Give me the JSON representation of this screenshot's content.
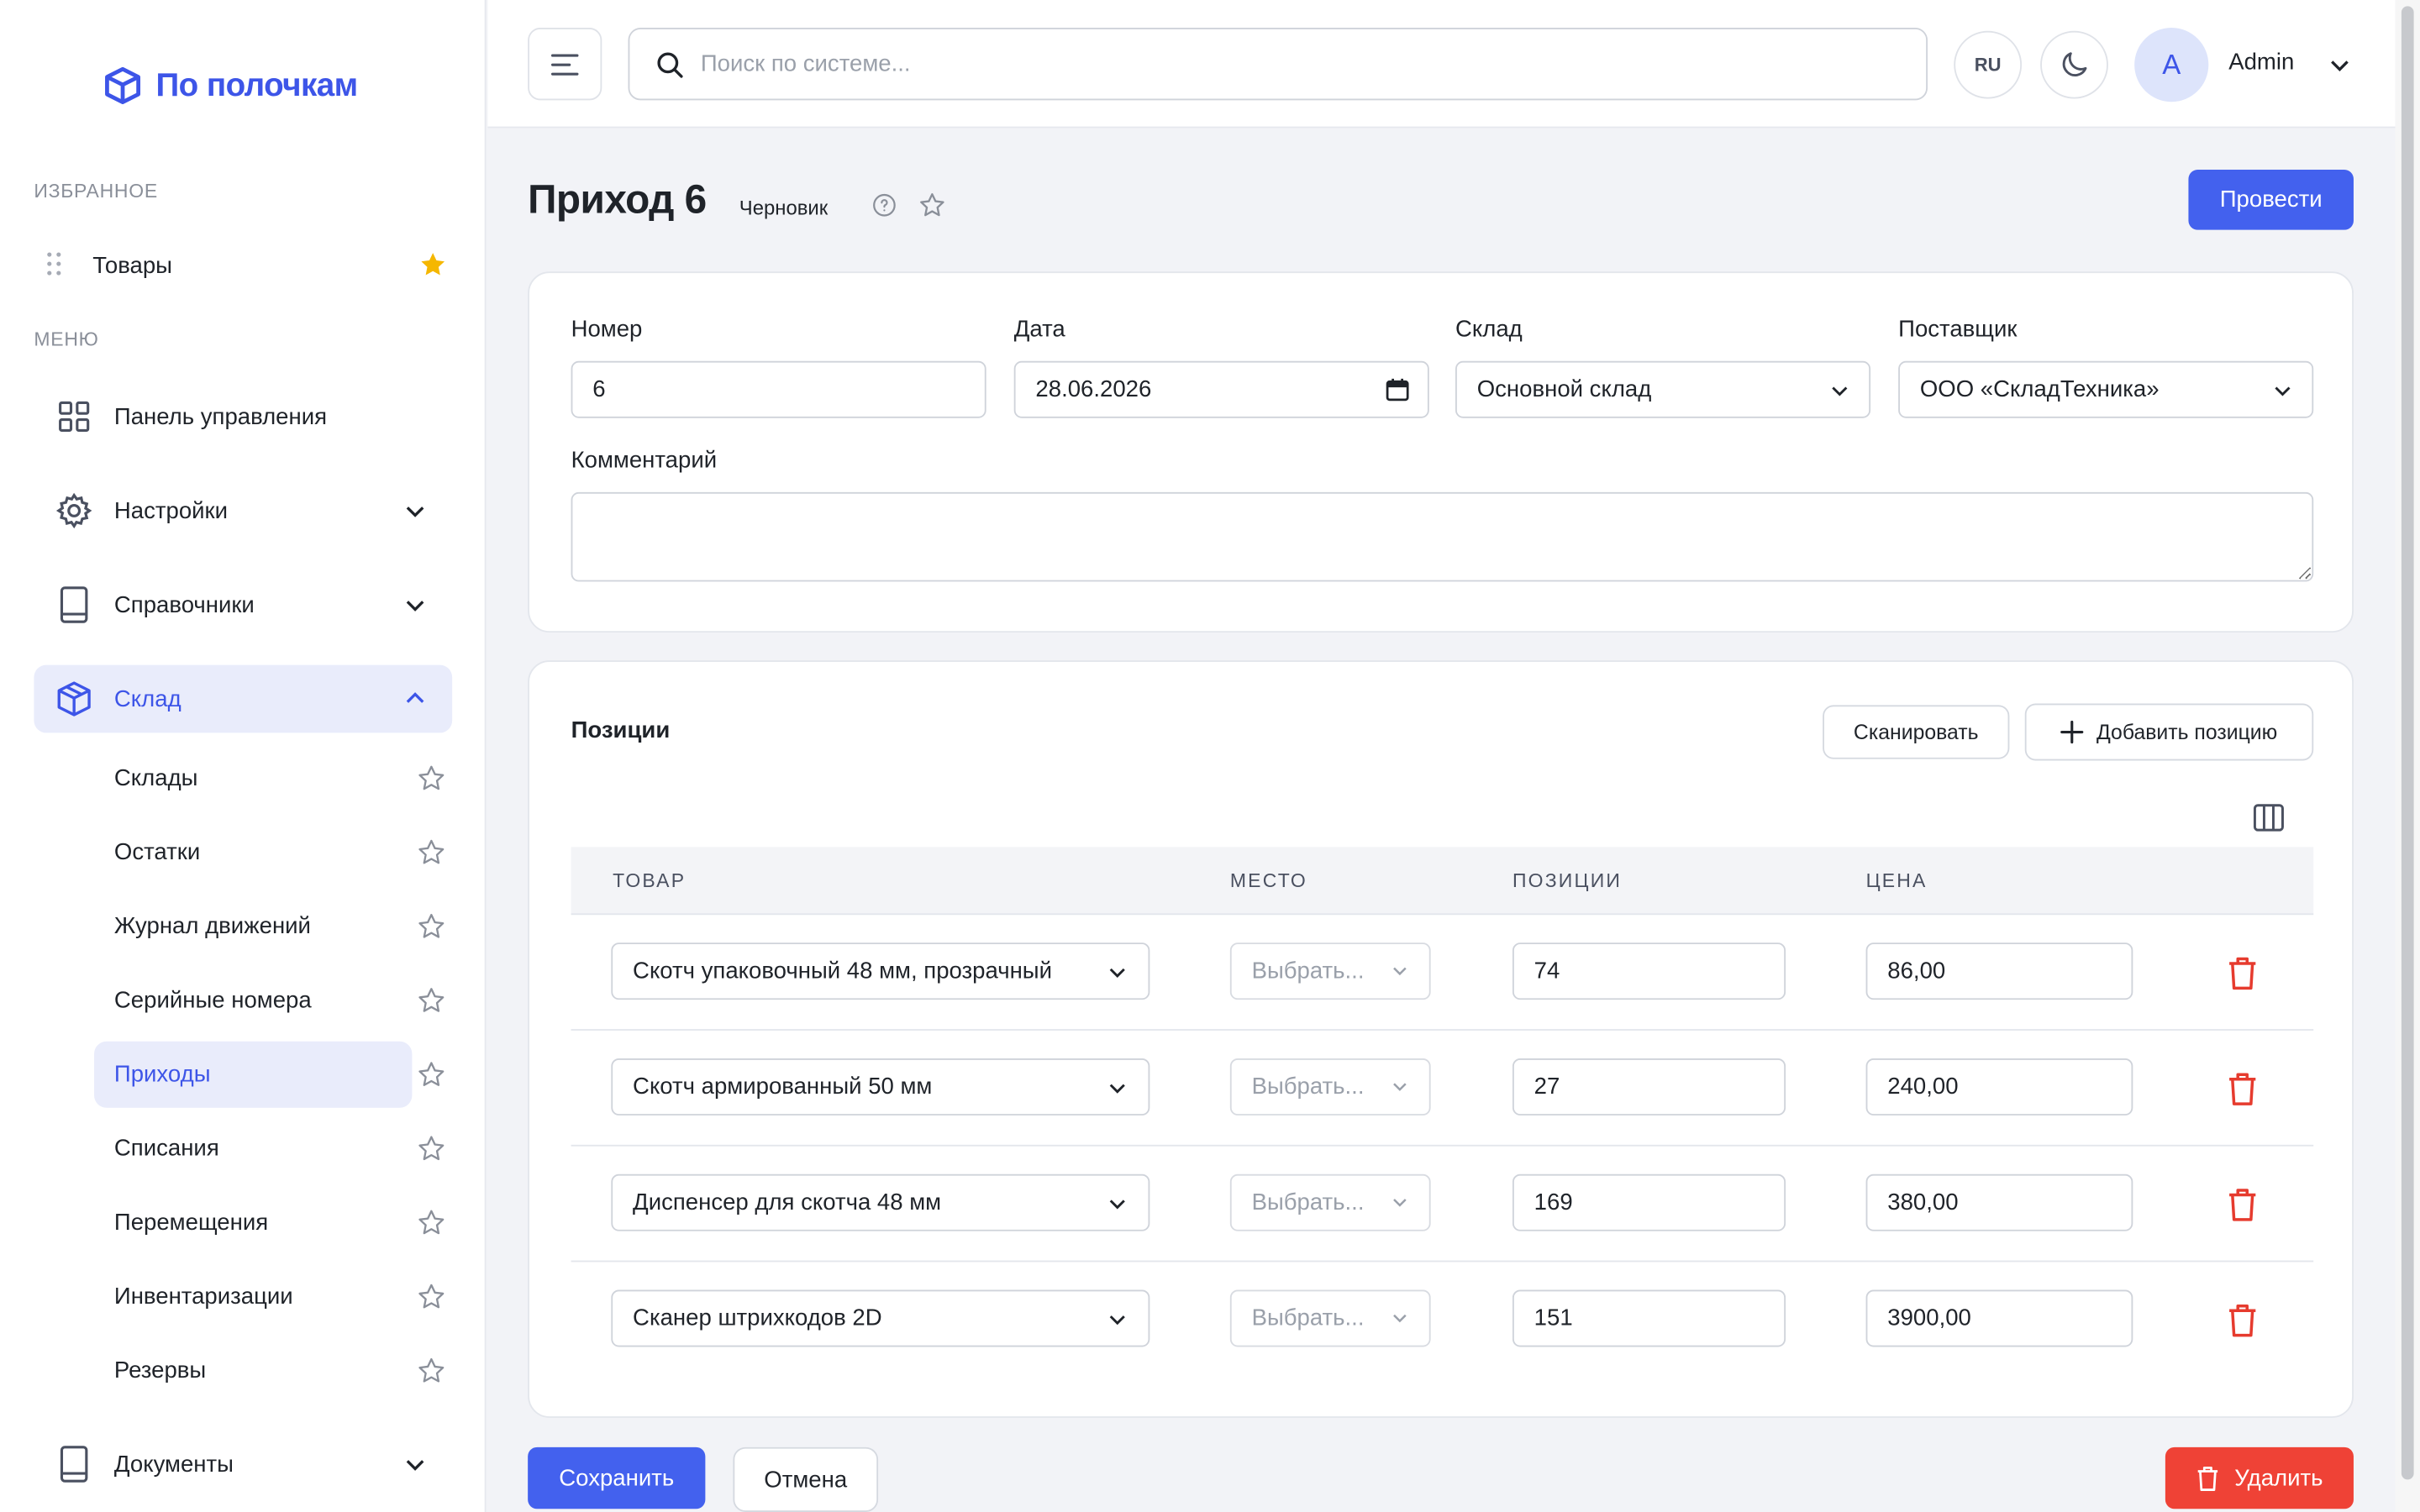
{
  "brand": {
    "name": "По полочкам",
    "color": "#3d55e8"
  },
  "sidebar": {
    "favorites_label": "ИЗБРАННОЕ",
    "favorites": [
      {
        "label": "Товары",
        "starred": true
      }
    ],
    "menu_label": "МЕНЮ",
    "items": [
      {
        "label": "Панель управления",
        "icon": "dashboard-icon"
      },
      {
        "label": "Настройки",
        "icon": "gear-icon",
        "expandable": true
      },
      {
        "label": "Справочники",
        "icon": "book-icon",
        "expandable": true
      },
      {
        "label": "Склад",
        "icon": "box-icon",
        "expanded": true,
        "active": true
      },
      {
        "label": "Документы",
        "icon": "book-icon",
        "expandable": true
      }
    ],
    "sklad_sub": [
      {
        "label": "Склады"
      },
      {
        "label": "Остатки"
      },
      {
        "label": "Журнал движений"
      },
      {
        "label": "Серийные номера"
      },
      {
        "label": "Приходы",
        "active": true
      },
      {
        "label": "Списания"
      },
      {
        "label": "Перемещения"
      },
      {
        "label": "Инвентаризации"
      },
      {
        "label": "Резервы"
      }
    ]
  },
  "topbar": {
    "search_placeholder": "Поиск по системе...",
    "lang": "RU",
    "avatar_letter": "A",
    "user_name": "Admin"
  },
  "page": {
    "title": "Приход 6",
    "status": "Черновик",
    "post_button": "Провести"
  },
  "form": {
    "number": {
      "label": "Номер",
      "value": "6"
    },
    "date": {
      "label": "Дата",
      "value": "28.06.2026"
    },
    "warehouse": {
      "label": "Склад",
      "value": "Основной склад"
    },
    "supplier": {
      "label": "Поставщик",
      "value": "ООО «СкладТехника»"
    },
    "comment": {
      "label": "Комментарий",
      "value": ""
    }
  },
  "positions": {
    "title": "Позиции",
    "scan_button": "Сканировать",
    "add_button": "Добавить позицию",
    "columns": [
      "ТОВАР",
      "МЕСТО",
      "ПОЗИЦИИ",
      "ЦЕНА"
    ],
    "place_placeholder": "Выбрать...",
    "rows": [
      {
        "product": "Скотч упаковочный 48 мм, прозрачный",
        "qty": "74",
        "price": "86,00"
      },
      {
        "product": "Скотч армированный 50 мм",
        "qty": "27",
        "price": "240,00"
      },
      {
        "product": "Диспенсер для скотча 48 мм",
        "qty": "169",
        "price": "380,00"
      },
      {
        "product": "Сканер штрихкодов 2D",
        "qty": "151",
        "price": "3900,00"
      }
    ]
  },
  "footer": {
    "save_button": "Сохранить",
    "cancel_button": "Отмена",
    "delete_button": "Удалить"
  },
  "colors": {
    "primary": "#4361ee",
    "danger": "#ef4236",
    "star": "#f5b700"
  }
}
